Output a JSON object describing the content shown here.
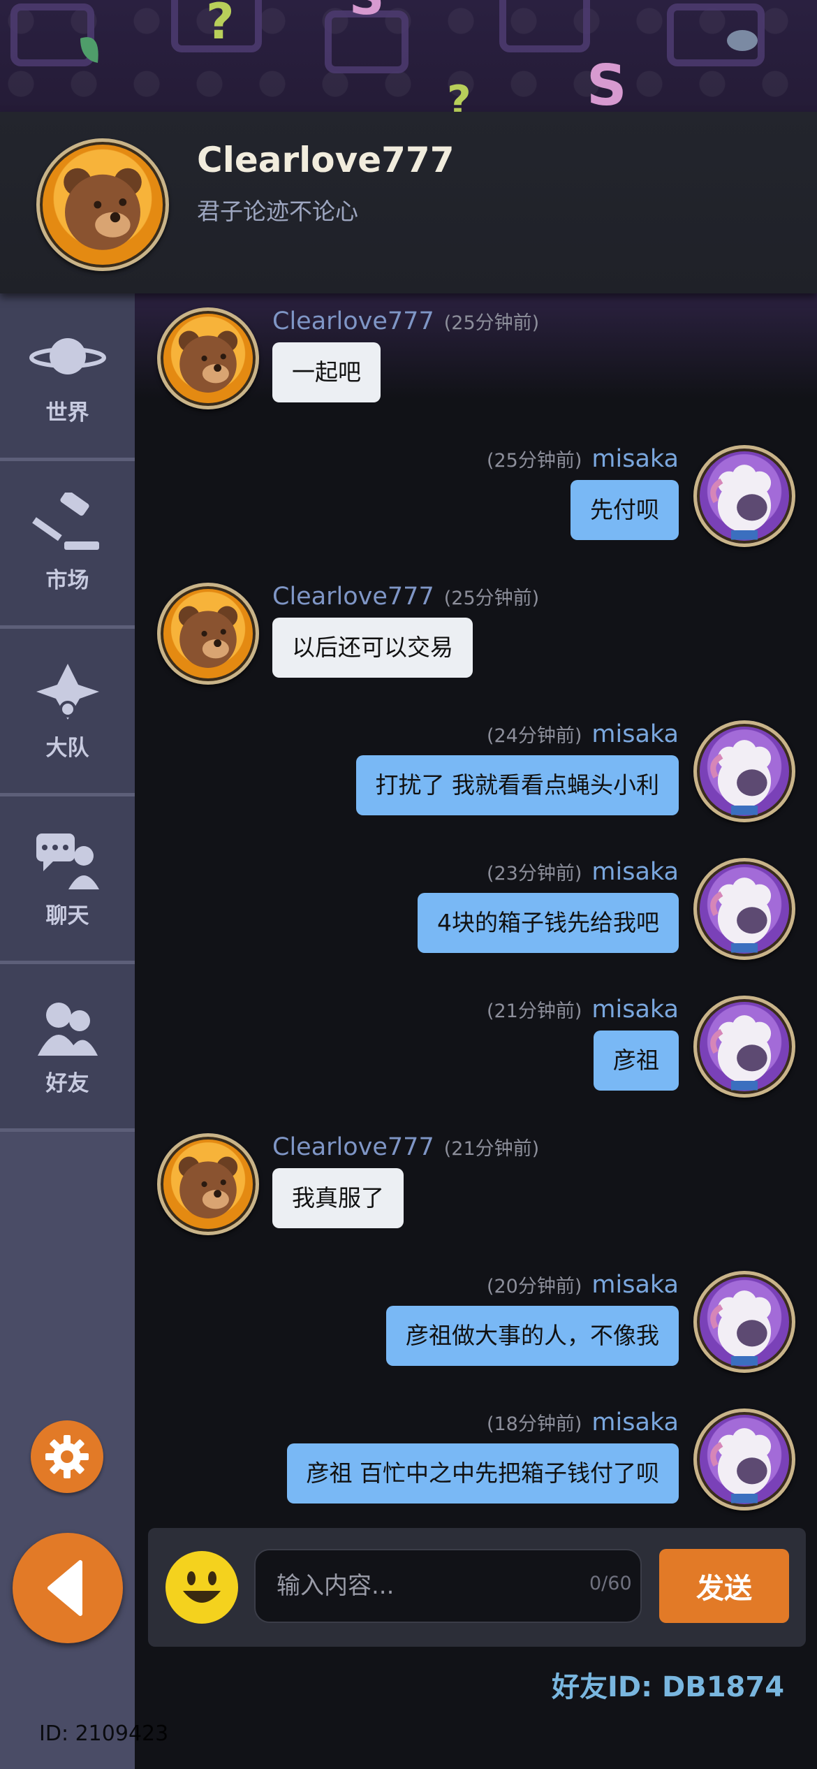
{
  "header": {
    "name": "Clearlove777",
    "motto": "君子论迹不论心"
  },
  "sidebar": {
    "items": [
      {
        "label": "世界",
        "icon": "planet-icon"
      },
      {
        "label": "市场",
        "icon": "gavel-icon"
      },
      {
        "label": "大队",
        "icon": "team-emblem-icon"
      },
      {
        "label": "聊天",
        "icon": "chat-icon"
      },
      {
        "label": "好友",
        "icon": "friends-icon"
      }
    ]
  },
  "messages": [
    {
      "sender": "Clearlove777",
      "time": "(25分钟前)",
      "text": "一起吧",
      "outgoing": false
    },
    {
      "sender": "misaka",
      "time": "(25分钟前)",
      "text": "先付呗",
      "outgoing": true
    },
    {
      "sender": "Clearlove777",
      "time": "(25分钟前)",
      "text": "以后还可以交易",
      "outgoing": false
    },
    {
      "sender": "misaka",
      "time": "(24分钟前)",
      "text": "打扰了 我就看看点蝇头小利",
      "outgoing": true
    },
    {
      "sender": "misaka",
      "time": "(23分钟前)",
      "text": "4块的箱子钱先给我吧",
      "outgoing": true
    },
    {
      "sender": "misaka",
      "time": "(21分钟前)",
      "text": "彦祖",
      "outgoing": true
    },
    {
      "sender": "Clearlove777",
      "time": "(21分钟前)",
      "text": "我真服了",
      "outgoing": false
    },
    {
      "sender": "misaka",
      "time": "(20分钟前)",
      "text": "彦祖做大事的人，不像我",
      "outgoing": true
    },
    {
      "sender": "misaka",
      "time": "(18分钟前)",
      "text": "彦祖 百忙中之中先把箱子钱付了呗",
      "outgoing": true
    }
  ],
  "input": {
    "placeholder": "输入内容...",
    "counter": "0/60",
    "send_label": "发送"
  },
  "footer": {
    "friend_id": "好友ID: DB1874",
    "user_id": "ID: 2109423"
  },
  "colors": {
    "accent": "#e27a27",
    "outgoing_bubble": "#79b8f5",
    "incoming_bubble": "#eceff3",
    "sidebar": "#3f4159"
  }
}
